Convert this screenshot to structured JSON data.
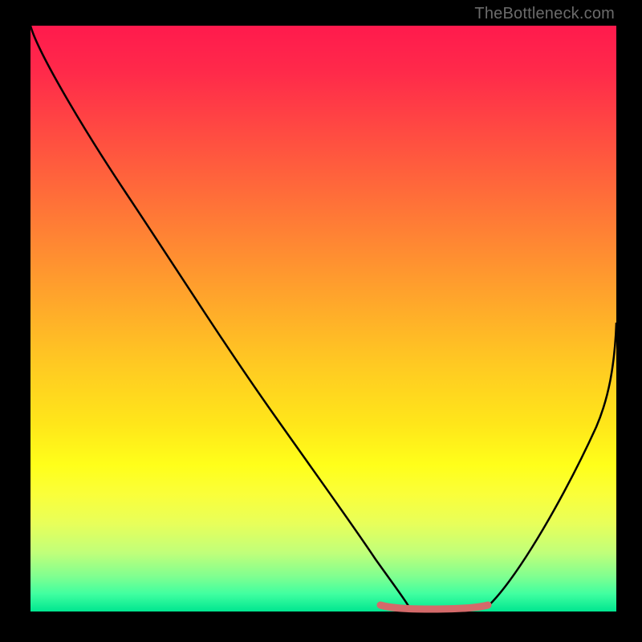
{
  "attribution": "TheBottleneck.com",
  "chart_data": {
    "type": "line",
    "title": "",
    "xlabel": "",
    "ylabel": "",
    "xlim": [
      0,
      100
    ],
    "ylim": [
      0,
      100
    ],
    "background_gradient": [
      "#ff1a4d",
      "#ff8a32",
      "#ffff1a",
      "#00e690"
    ],
    "series": [
      {
        "name": "left-curve",
        "x": [
          0,
          5,
          12,
          20,
          28,
          36,
          44,
          52,
          58,
          62,
          65
        ],
        "y": [
          100,
          95,
          86,
          75,
          63,
          51,
          38,
          25,
          14,
          6,
          0
        ]
      },
      {
        "name": "right-curve",
        "x": [
          78,
          82,
          86,
          90,
          94,
          97,
          100
        ],
        "y": [
          0,
          5,
          12,
          20,
          30,
          40,
          50
        ]
      },
      {
        "name": "flat-highlight",
        "x": [
          60,
          63,
          66,
          70,
          73,
          76,
          79
        ],
        "y": [
          1,
          0.5,
          0.3,
          0.3,
          0.3,
          0.5,
          1
        ],
        "color": "#d46a6a"
      }
    ],
    "annotations": []
  }
}
